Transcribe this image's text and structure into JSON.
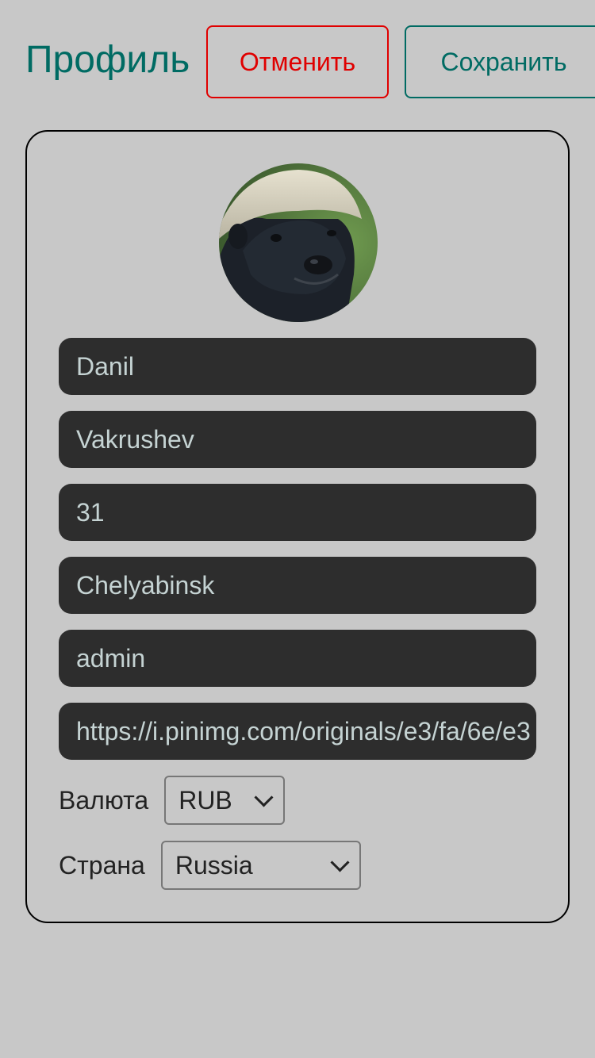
{
  "header": {
    "title": "Профиль",
    "cancel_label": "Отменить",
    "save_label": "Сохранить"
  },
  "profile": {
    "avatar_icon": "honey-badger-photo",
    "first_name": "Danil",
    "last_name": "Vakrushev",
    "age": "31",
    "city": "Chelyabinsk",
    "role": "admin",
    "avatar_url": "https://i.pinimg.com/originals/e3/fa/6e/e3"
  },
  "currency": {
    "label": "Валюта",
    "selected": "RUB"
  },
  "country": {
    "label": "Страна",
    "selected": "Russia"
  },
  "colors": {
    "background": "#c8c8c8",
    "accent": "#006b63",
    "danger": "#e00000",
    "field_bg": "#2d2d2d",
    "field_text": "#c5d3d3"
  }
}
